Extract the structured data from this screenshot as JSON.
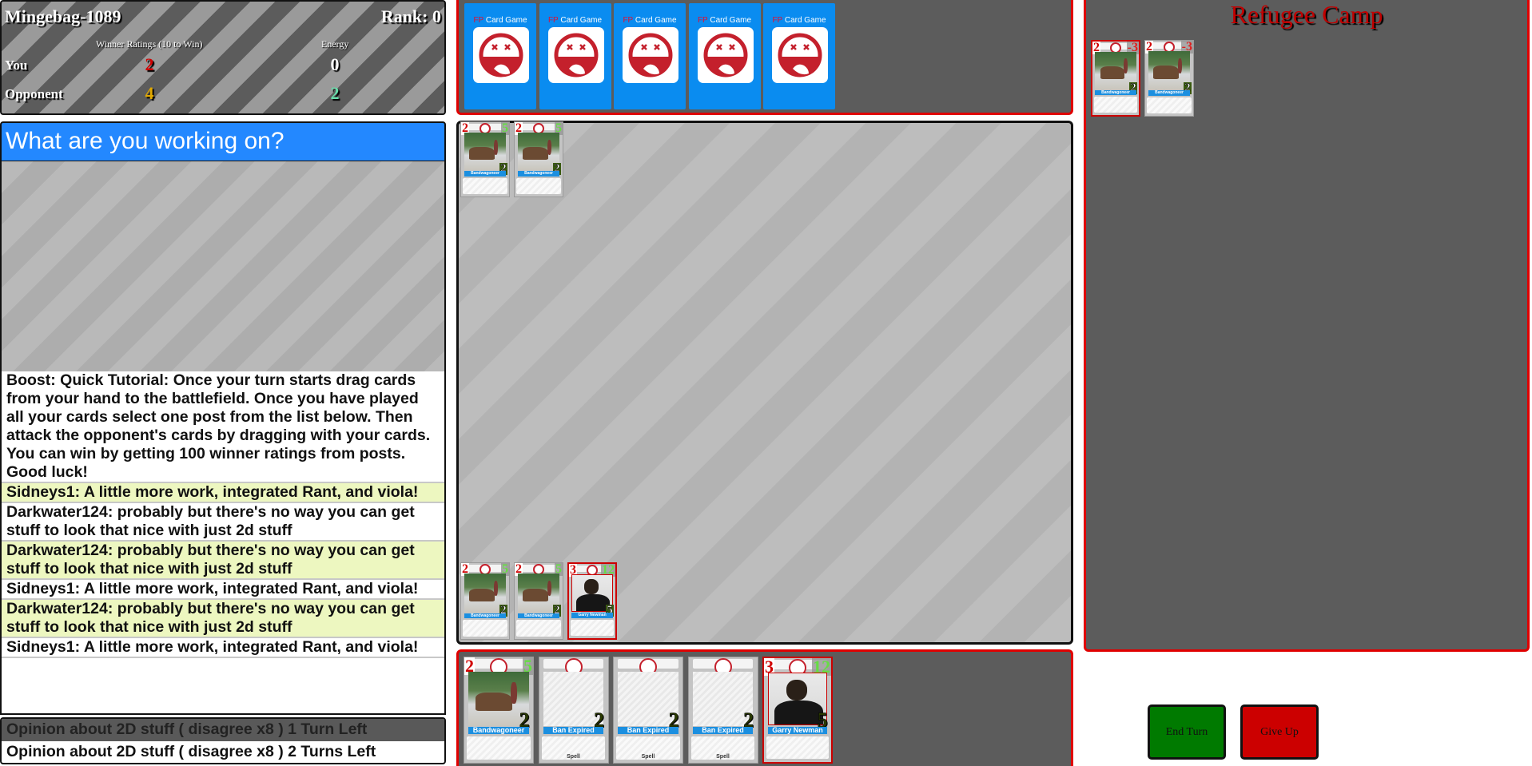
{
  "stats": {
    "player_name": "Mingebag-1089",
    "rank_label": "Rank: 0",
    "ratings_header": "Winner Ratings (10 to Win)",
    "energy_header": "Energy",
    "rows": [
      {
        "label": "You",
        "ratings": "2",
        "energy": "0",
        "ratings_color": "#d00000",
        "energy_color": "#ffffff"
      },
      {
        "label": "Opponent",
        "ratings": "4",
        "energy": "2",
        "ratings_color": "#e0a800",
        "energy_color": "#66ddaa"
      }
    ]
  },
  "topic": {
    "title": "What are you working on?"
  },
  "chat": {
    "messages": [
      {
        "text": "Boost: Quick Tutorial: Once your turn starts drag cards from your hand to the battlefield. Once you have played all your cards select one post from the list below. Then attack the opponent's cards by dragging with your cards. You can win by getting 100 winner ratings from posts. Good luck!",
        "highlight": false
      },
      {
        "text": "Sidneys1: A little more work, integrated Rant, and viola!",
        "highlight": true
      },
      {
        "text": "Darkwater124: probably but there's no way you can get stuff to look that nice with just 2d stuff",
        "highlight": false
      },
      {
        "text": "Darkwater124: probably but there's no way you can get stuff to look that nice with just 2d stuff",
        "highlight": true
      },
      {
        "text": "Sidneys1: A little more work, integrated Rant, and viola!",
        "highlight": false
      },
      {
        "text": "Darkwater124: probably but there's no way you can get stuff to look that nice with just 2d stuff",
        "highlight": true
      },
      {
        "text": "Sidneys1: A little more work, integrated Rant, and viola!",
        "highlight": false
      }
    ]
  },
  "posts": [
    {
      "text": "Opinion about 2D stuff ( disagree x8 ) 1 Turn Left",
      "selected": true
    },
    {
      "text": "Opinion about 2D stuff ( disagree x8 ) 2 Turns Left",
      "selected": false
    }
  ],
  "opponent_hand": {
    "card_back_brand": "FP",
    "card_back_title": "Card Game",
    "count": 5
  },
  "battlefield": {
    "opponent_cards": [
      {
        "name": "Bandwagoneer",
        "cost": "2",
        "hp": "5",
        "attack": "2",
        "art": "horse"
      },
      {
        "name": "Bandwagoneer",
        "cost": "2",
        "hp": "5",
        "attack": "2",
        "art": "horse"
      }
    ],
    "player_cards": [
      {
        "name": "Bandwagoneer",
        "cost": "2",
        "hp": "5",
        "attack": "2",
        "art": "horse"
      },
      {
        "name": "Bandwagoneer",
        "cost": "2",
        "hp": "5",
        "attack": "2",
        "art": "horse"
      },
      {
        "name": "Garry Newman",
        "cost": "3",
        "hp": "12",
        "attack": "5",
        "art": "man"
      }
    ]
  },
  "player_hand": [
    {
      "name": "Bandwagoneer",
      "cost": "2",
      "hp": "5",
      "attack": "2",
      "art": "horse",
      "type": ""
    },
    {
      "name": "Ban Expired",
      "cost": "",
      "hp": "",
      "attack": "2",
      "art": "blank",
      "type": "Spell"
    },
    {
      "name": "Ban Expired",
      "cost": "",
      "hp": "",
      "attack": "2",
      "art": "blank",
      "type": "Spell"
    },
    {
      "name": "Ban Expired",
      "cost": "",
      "hp": "",
      "attack": "2",
      "art": "blank",
      "type": "Spell"
    },
    {
      "name": "Garry Newman",
      "cost": "3",
      "hp": "12",
      "attack": "5",
      "art": "man",
      "type": ""
    }
  ],
  "refugee_camp": {
    "title": "Refugee Camp",
    "cards": [
      {
        "name": "Bandwagoneer",
        "cost": "2",
        "hp": "-3",
        "attack": "2",
        "art": "horse",
        "selected": true
      },
      {
        "name": "Bandwagoneer",
        "cost": "2",
        "hp": "-3",
        "attack": "2",
        "art": "horse",
        "selected": false
      }
    ]
  },
  "buttons": {
    "end_turn": "End Turn",
    "give_up": "Give Up"
  },
  "colors": {
    "accent_blue": "#2388ff",
    "card_back_blue": "#0a8cf0",
    "zone_red": "#e00000",
    "end_turn_green": "#007a00",
    "give_up_red": "#cc0000"
  }
}
